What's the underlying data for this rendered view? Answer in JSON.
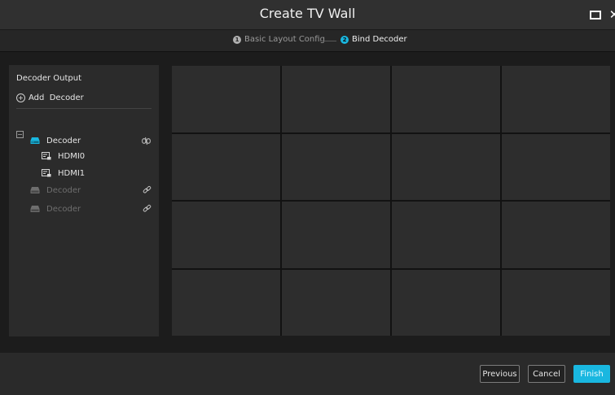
{
  "window": {
    "title": "Create TV Wall"
  },
  "stepper": {
    "steps": [
      {
        "number": "1",
        "label": "Basic Layout Config",
        "active": false
      },
      {
        "number": "2",
        "label": "Bind Decoder",
        "active": true
      }
    ]
  },
  "left_panel": {
    "title": "Decoder Output",
    "add_label": "Add  Decoder",
    "tree": [
      {
        "label": "Decoder",
        "expanded": true,
        "state": "bound",
        "icon": "decoder-icon",
        "children": [
          {
            "label": "HDMI0",
            "icon": "hdmi-output-icon"
          },
          {
            "label": "HDMI1",
            "icon": "hdmi-output-icon"
          }
        ]
      },
      {
        "label": "Decoder",
        "state": "unbound",
        "icon": "decoder-icon"
      },
      {
        "label": "Decoder",
        "state": "unbound",
        "icon": "decoder-icon"
      }
    ]
  },
  "grid": {
    "rows": 4,
    "cols": 4
  },
  "footer": {
    "previous_label": "Previous",
    "cancel_label": "Cancel",
    "finish_label": "Finish"
  },
  "colors": {
    "accent": "#19b7e0",
    "background": "#1c1c1c",
    "panel": "#2b2b2b",
    "cell": "#2d2d2d"
  }
}
